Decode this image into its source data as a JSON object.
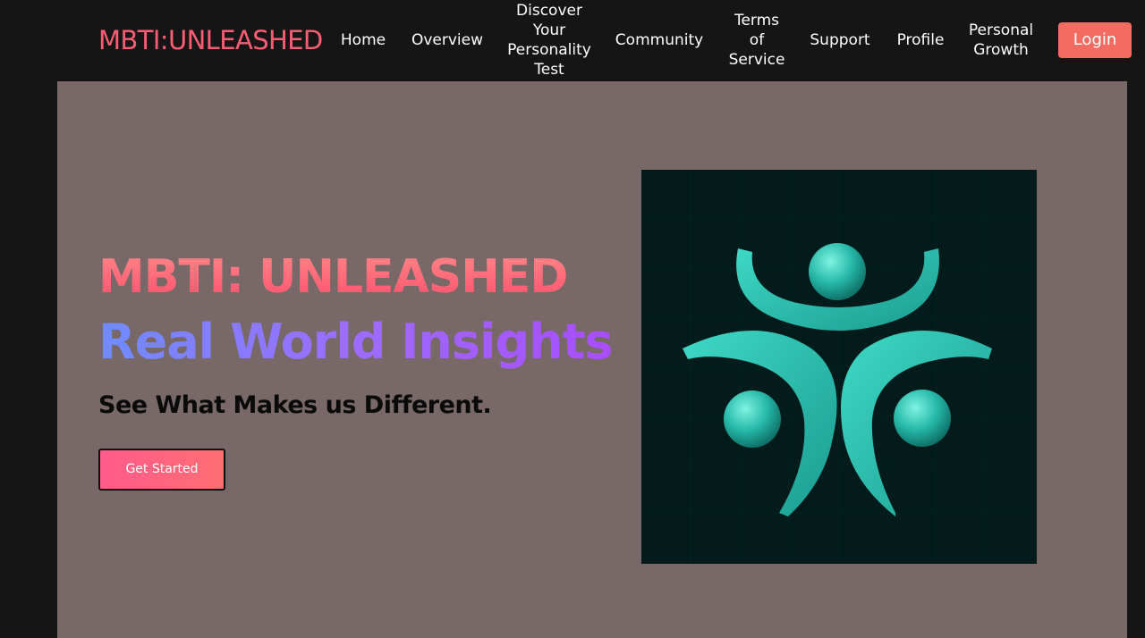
{
  "header": {
    "brand": "MBTI:UNLEASHED",
    "nav": [
      {
        "label": "Home"
      },
      {
        "label": "Overview"
      },
      {
        "label": "Discover\nYour\nPersonality\nTest"
      },
      {
        "label": "Community"
      },
      {
        "label": "Terms\nof\nService"
      },
      {
        "label": "Support"
      },
      {
        "label": "Profile"
      },
      {
        "label": "Personal\nGrowth"
      }
    ],
    "login_label": "Login"
  },
  "hero": {
    "title": "MBTI: UNLEASHED",
    "subtitle": "Real World Insights",
    "tagline": "See What Makes us Different.",
    "cta_label": "Get Started"
  },
  "colors": {
    "brand": "#ff5d73",
    "login_button": "#f46b62",
    "hero_background": "#786968",
    "logo_background": "#031b1b",
    "logo_teal": "#2bc5b4"
  },
  "icons": {
    "logo": "three-people-teal-logo-icon"
  }
}
